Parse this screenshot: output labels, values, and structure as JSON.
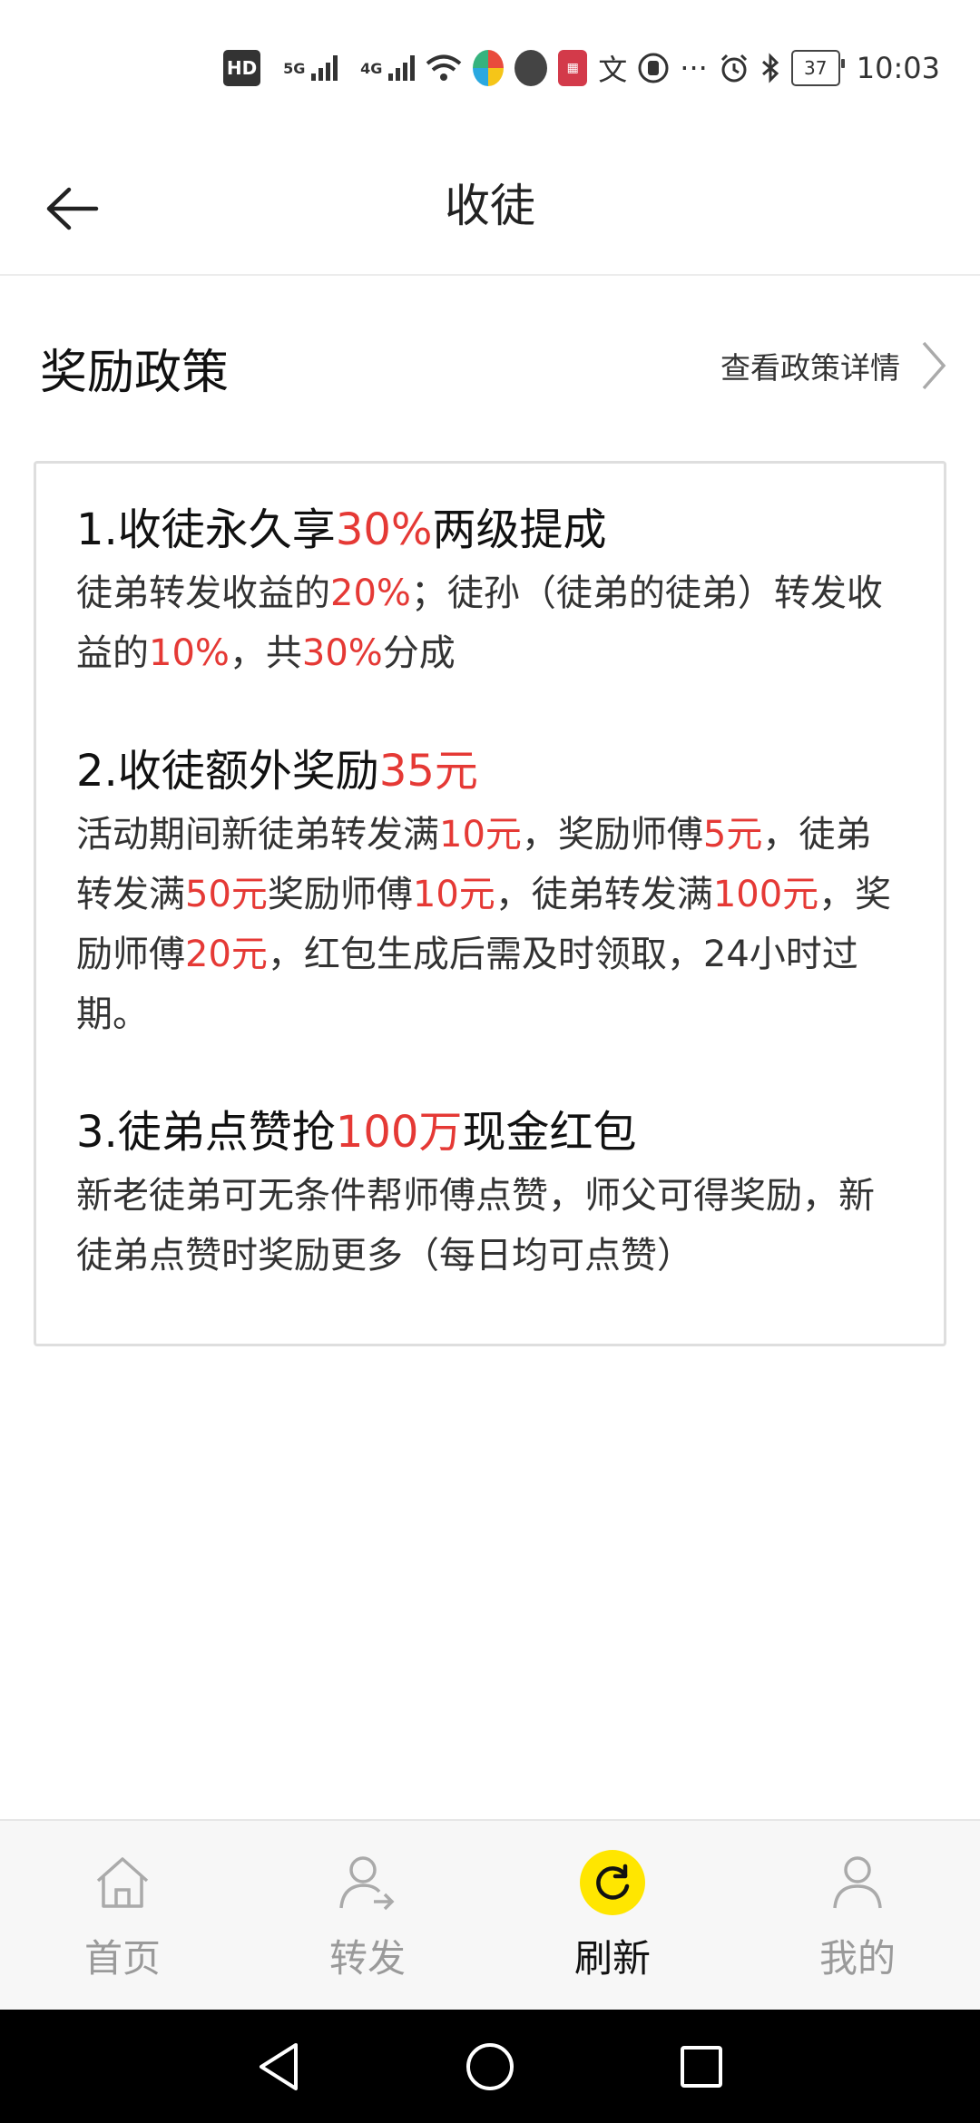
{
  "status_bar": {
    "hd": "HD",
    "net1": "5G",
    "net2": "4G",
    "app_label": "app",
    "glyph_wen": "文",
    "more": "···",
    "battery": "37",
    "time": "10:03"
  },
  "nav": {
    "title": "收徒"
  },
  "policy": {
    "title": "奖励政策",
    "detail_link": "查看政策详情"
  },
  "items": [
    {
      "title": [
        "1.收徒永久享",
        "30%",
        "两级提成"
      ],
      "body": [
        "徒弟转发收益的",
        "20%",
        "；徒孙（徒弟的徒弟）转发收益的",
        "10%",
        "，共",
        "30%",
        "分成"
      ]
    },
    {
      "title": [
        "2.收徒额外奖励",
        "35元"
      ],
      "body": [
        "活动期间新徒弟转发满",
        "10元",
        "，奖励师傅",
        "5元",
        "，徒弟转发满",
        "50元",
        "奖励师傅",
        "10元",
        "，徒弟转发满",
        "100元",
        "，奖励师傅",
        "20元",
        "，红包生成后需及时领取，24小时过期。"
      ]
    },
    {
      "title": [
        "3.徒弟点赞抢",
        "100万",
        "现金红包"
      ],
      "body": [
        "新老徒弟可无条件帮师傅点赞，师父可得奖励，新徒弟点赞时奖励更多（每日均可点赞）"
      ]
    }
  ],
  "tabs": [
    {
      "label": "首页",
      "icon": "home-icon"
    },
    {
      "label": "转发",
      "icon": "share-user-icon"
    },
    {
      "label": "刷新",
      "icon": "refresh-icon"
    },
    {
      "label": "我的",
      "icon": "profile-icon"
    }
  ],
  "active_tab": "刷新",
  "colors": {
    "highlight": "#e53935",
    "accent": "#ffe600"
  }
}
